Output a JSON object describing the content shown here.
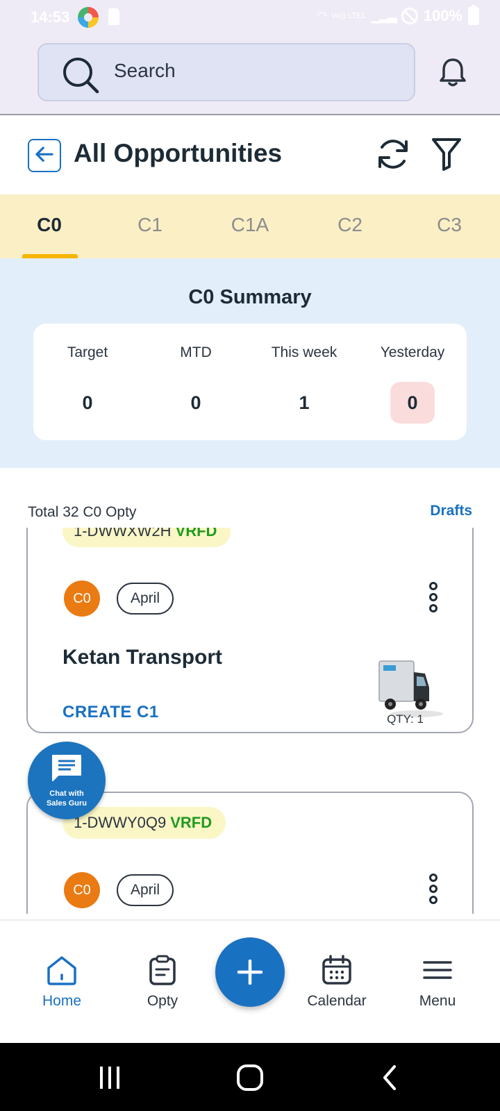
{
  "status_bar": {
    "time": "14:53",
    "network": "Vo)) LTE1",
    "battery": "100%"
  },
  "search": {
    "placeholder": "Search"
  },
  "header": {
    "title": "All Opportunities"
  },
  "tabs": [
    {
      "label": "C0",
      "active": true
    },
    {
      "label": "C1",
      "active": false
    },
    {
      "label": "C1A",
      "active": false
    },
    {
      "label": "C2",
      "active": false
    },
    {
      "label": "C3",
      "active": false
    }
  ],
  "summary": {
    "title": "C0 Summary",
    "stats": [
      {
        "label": "Target",
        "value": "0"
      },
      {
        "label": "MTD",
        "value": "0"
      },
      {
        "label": "This week",
        "value": "1"
      },
      {
        "label": "Yesterday",
        "value": "0"
      }
    ]
  },
  "list": {
    "total_label": "Total 32 C0 Opty",
    "drafts_label": "Drafts"
  },
  "cards": [
    {
      "opty_id": "1-DWWXW2H",
      "status": "VRFD",
      "stage": "C0",
      "month": "April",
      "customer": "Ketan Transport",
      "action": "CREATE C1",
      "qty": "QTY: 1"
    },
    {
      "opty_id": "1-DWWY0Q9",
      "status": "VRFD",
      "stage": "C0",
      "month": "April"
    }
  ],
  "chat": {
    "line1": "Chat with",
    "line2": "Sales Guru"
  },
  "bottom_nav": [
    {
      "label": "Home",
      "icon": "home-icon"
    },
    {
      "label": "Opty",
      "icon": "clipboard-icon"
    },
    {
      "label": "Calendar",
      "icon": "calendar-icon"
    },
    {
      "label": "Menu",
      "icon": "menu-icon"
    }
  ],
  "colors": {
    "accent": "#1971c2",
    "tab_bg": "#fbefc6",
    "summary_bg": "#e2effa",
    "badge": "#ea7a12",
    "verified": "#1e9b1e"
  }
}
